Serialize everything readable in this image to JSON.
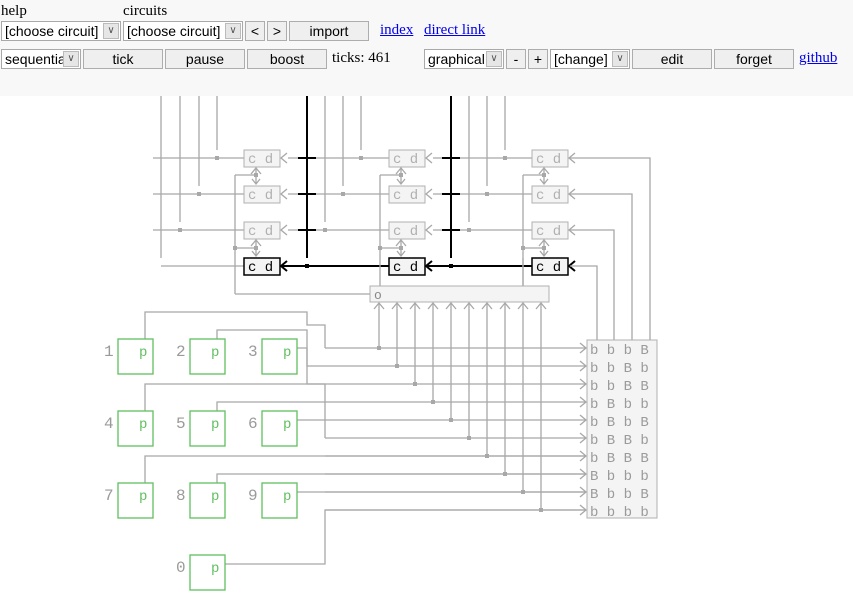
{
  "toolbar": {
    "row1": {
      "help_label": "help",
      "circuits_label": "circuits",
      "help_select": "[choose circuit]",
      "circuits_select": "[choose circuit]",
      "prev_label": "<",
      "next_label": ">",
      "import_label": "import",
      "index_link": "index",
      "direct_link": "direct link"
    },
    "row2": {
      "mode_select": "sequentia",
      "tick_label": "tick",
      "pause_label": "pause",
      "boost_label": "boost",
      "ticks_text": "ticks: 461",
      "view_select": "graphical",
      "zoom_out_label": "-",
      "zoom_in_label": "+",
      "change_select": "[change]",
      "edit_label": "edit",
      "forget_label": "forget",
      "github_link": "github"
    },
    "dropdown_icon": "chevron-down-icon"
  },
  "circuit": {
    "colors": {
      "wire_off": "#a8a8a8",
      "wire_on": "#000000",
      "switch_border": "#5fbf5f",
      "switch_text": "#5fbf5f",
      "cell_off_border": "#b0b0b0",
      "cell_fill": "#f4f4f4",
      "label_gray": "#9a9a9a"
    },
    "cell_label": "c d",
    "bus_label": "o",
    "switch_glyph": "p",
    "switches": [
      {
        "label": "1"
      },
      {
        "label": "2"
      },
      {
        "label": "3"
      },
      {
        "label": "4"
      },
      {
        "label": "5"
      },
      {
        "label": "6"
      },
      {
        "label": "7"
      },
      {
        "label": "8"
      },
      {
        "label": "9"
      },
      {
        "label": "0"
      }
    ],
    "memory_cells": {
      "columns": 3,
      "rows": 4,
      "active": [
        [
          0,
          3
        ],
        [
          1,
          3
        ],
        [
          2,
          3
        ]
      ]
    },
    "rom_rows": [
      "b b b B",
      "b b B b",
      "b b B B",
      "b B b b",
      "b B b B",
      "b B B b",
      "b B B B",
      "B b b b",
      "B b b B",
      "b b b b"
    ]
  }
}
